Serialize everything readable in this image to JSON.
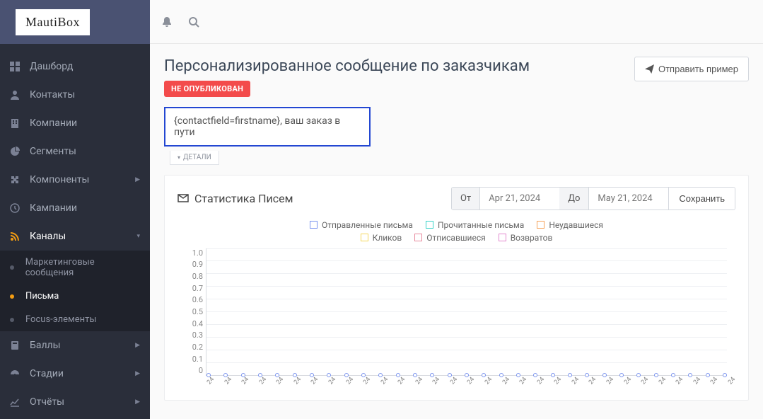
{
  "logo": "MautiBox",
  "sidebar": {
    "items": [
      {
        "id": "dashboard",
        "label": "Дашборд"
      },
      {
        "id": "contacts",
        "label": "Контакты"
      },
      {
        "id": "companies",
        "label": "Компании"
      },
      {
        "id": "segments",
        "label": "Сегменты"
      },
      {
        "id": "components",
        "label": "Компоненты",
        "expandable": true
      },
      {
        "id": "campaigns",
        "label": "Кампании"
      },
      {
        "id": "channels",
        "label": "Каналы",
        "expandable": true,
        "open": true
      },
      {
        "id": "points",
        "label": "Баллы",
        "expandable": true
      },
      {
        "id": "stages",
        "label": "Стадии",
        "expandable": true
      },
      {
        "id": "reports",
        "label": "Отчёты",
        "expandable": true
      }
    ],
    "channels_children": [
      {
        "id": "marketing-messages",
        "label": "Маркетинговые сообщения",
        "active": false
      },
      {
        "id": "emails",
        "label": "Письма",
        "active": true
      },
      {
        "id": "focus",
        "label": "Focus-элементы",
        "active": false
      }
    ]
  },
  "page": {
    "title": "Персонализированное сообщение по заказчикам",
    "status_badge": "НЕ ОПУБЛИКОВАН",
    "send_example": "Отправить пример",
    "subject": "{contactfield=firstname}, ваш заказ в пути",
    "details": "ДЕТАЛИ"
  },
  "stats": {
    "title": "Статистика Писем",
    "from_label": "От",
    "to_label": "До",
    "from_value": "Apr 21, 2024",
    "to_value": "May 21, 2024",
    "save": "Сохранить"
  },
  "chart_data": {
    "type": "line",
    "title": "Статистика Писем",
    "xlabel": "",
    "ylabel": "",
    "ylim": [
      0,
      1.0
    ],
    "y_ticks": [
      "1.0",
      "0.9",
      "0.8",
      "0.7",
      "0.6",
      "0.5",
      "0.4",
      "0.3",
      "0.2",
      "0.1",
      "0"
    ],
    "categories": [
      "24",
      "24",
      "24",
      "24",
      "24",
      "24",
      "24",
      "24",
      "24",
      "24",
      "24",
      "24",
      "24",
      "24",
      "24",
      "24",
      "24",
      "24",
      "24",
      "24",
      "24",
      "24",
      "24",
      "24",
      "24",
      "24",
      "24",
      "24",
      "24",
      "24",
      "24"
    ],
    "series": [
      {
        "name": "Отправленные письма",
        "color": "#7b94ef",
        "values": [
          0,
          0,
          0,
          0,
          0,
          0,
          0,
          0,
          0,
          0,
          0,
          0,
          0,
          0,
          0,
          0,
          0,
          0,
          0,
          0,
          0,
          0,
          0,
          0,
          0,
          0,
          0,
          0,
          0,
          0,
          0
        ]
      },
      {
        "name": "Прочитанные письма",
        "color": "#3bd3c9",
        "values": [
          0,
          0,
          0,
          0,
          0,
          0,
          0,
          0,
          0,
          0,
          0,
          0,
          0,
          0,
          0,
          0,
          0,
          0,
          0,
          0,
          0,
          0,
          0,
          0,
          0,
          0,
          0,
          0,
          0,
          0,
          0
        ]
      },
      {
        "name": "Неудавшиеся",
        "color": "#f6a35c",
        "values": [
          0,
          0,
          0,
          0,
          0,
          0,
          0,
          0,
          0,
          0,
          0,
          0,
          0,
          0,
          0,
          0,
          0,
          0,
          0,
          0,
          0,
          0,
          0,
          0,
          0,
          0,
          0,
          0,
          0,
          0,
          0
        ]
      },
      {
        "name": "Кликов",
        "color": "#f5d95f",
        "values": [
          0,
          0,
          0,
          0,
          0,
          0,
          0,
          0,
          0,
          0,
          0,
          0,
          0,
          0,
          0,
          0,
          0,
          0,
          0,
          0,
          0,
          0,
          0,
          0,
          0,
          0,
          0,
          0,
          0,
          0,
          0
        ]
      },
      {
        "name": "Отписавшиеся",
        "color": "#e88b9f",
        "values": [
          0,
          0,
          0,
          0,
          0,
          0,
          0,
          0,
          0,
          0,
          0,
          0,
          0,
          0,
          0,
          0,
          0,
          0,
          0,
          0,
          0,
          0,
          0,
          0,
          0,
          0,
          0,
          0,
          0,
          0,
          0
        ]
      },
      {
        "name": "Возвратов",
        "color": "#e38bd0",
        "values": [
          0,
          0,
          0,
          0,
          0,
          0,
          0,
          0,
          0,
          0,
          0,
          0,
          0,
          0,
          0,
          0,
          0,
          0,
          0,
          0,
          0,
          0,
          0,
          0,
          0,
          0,
          0,
          0,
          0,
          0,
          0
        ]
      }
    ]
  }
}
